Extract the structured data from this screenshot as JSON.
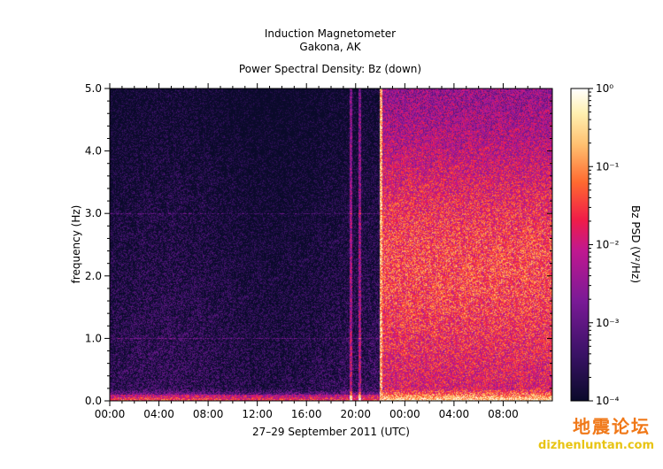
{
  "chart_data": {
    "type": "heatmap",
    "title": "Induction Magnetometer",
    "subtitle": "Gakona, AK",
    "plot_title": "Power Spectral Density: Bz (down)",
    "xlabel": "27–29 September 2011 (UTC)",
    "ylabel": "frequency (Hz)",
    "ylim": [
      0,
      5
    ],
    "y_ticks": [
      "0.0",
      "1.0",
      "2.0",
      "3.0",
      "4.0",
      "5.0"
    ],
    "x_ticks": [
      "00:00",
      "04:00",
      "08:00",
      "12:00",
      "16:00",
      "20:00",
      "00:00",
      "04:00",
      "08:00"
    ],
    "x_range_hours": [
      0,
      36
    ],
    "colorbar": {
      "label": "Bz PSD (V²/Hz)",
      "scale": "log",
      "range": [
        0.0001,
        1
      ],
      "ticks": [
        "10⁻⁴",
        "10⁻³",
        "10⁻²",
        "10⁻¹",
        "10⁰"
      ]
    },
    "features": {
      "quiet_level_log10": -3.6,
      "active_level_log10": -1.6,
      "transition_hour": 22.0,
      "spike_hours": [
        19.6,
        20.3
      ],
      "harmonic_lines_hz": [
        1.0,
        3.0
      ]
    }
  },
  "watermark": {
    "cn": "地震论坛",
    "url": "dizhenluntan.com"
  },
  "colors": {
    "dark": "#1a0a3c",
    "mid": "#8c1a9a",
    "bright": "#ff2040",
    "hot": "#ffe890"
  }
}
